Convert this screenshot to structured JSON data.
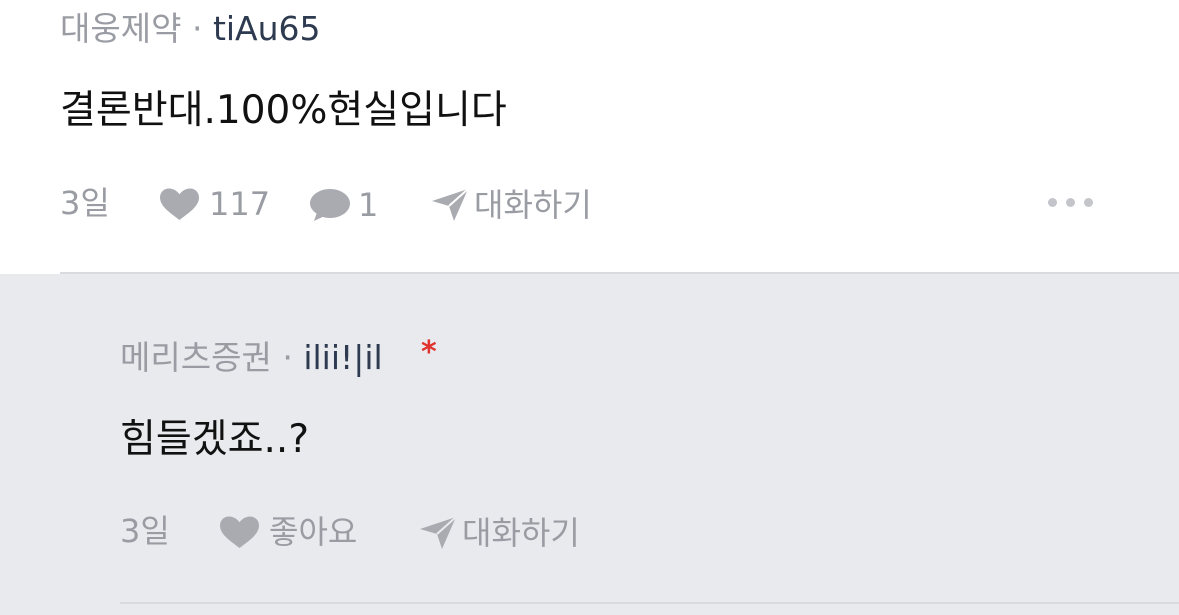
{
  "top_comment": {
    "company": "대웅제약",
    "separator": "·",
    "nickname": "tiAu65",
    "text": "결론반대.100%현실입니다",
    "time": "3일",
    "likes": "117",
    "comments": "1",
    "reply_label": "대화하기",
    "more_icon": "more-horizontal-icon"
  },
  "reply_comment": {
    "company": "메리츠증권",
    "separator": "·",
    "nickname": "ilii!|il",
    "op_marker": "*",
    "text": "힘들겠죠..?",
    "time": "3일",
    "like_label": "좋아요",
    "reply_label": "대화하기"
  },
  "colors": {
    "muted": "#9a9ca3",
    "nickname": "#2d3a4f",
    "reply_background": "#e9eaee",
    "op_marker": "#e0332f"
  }
}
